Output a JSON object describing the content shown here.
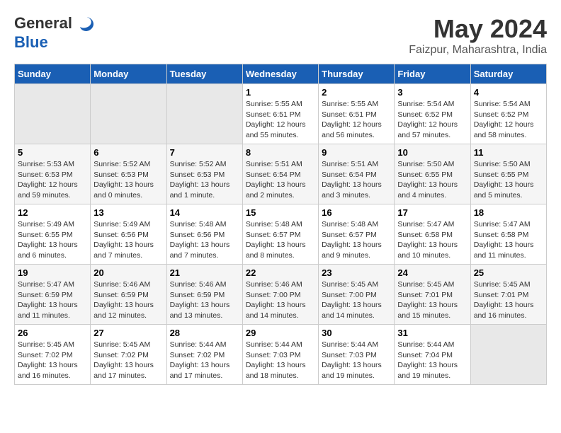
{
  "logo": {
    "line1": "General",
    "line2": "Blue"
  },
  "title": "May 2024",
  "subtitle": "Faizpur, Maharashtra, India",
  "days_of_week": [
    "Sunday",
    "Monday",
    "Tuesday",
    "Wednesday",
    "Thursday",
    "Friday",
    "Saturday"
  ],
  "weeks": [
    [
      {
        "num": "",
        "info": ""
      },
      {
        "num": "",
        "info": ""
      },
      {
        "num": "",
        "info": ""
      },
      {
        "num": "1",
        "info": "Sunrise: 5:55 AM\nSunset: 6:51 PM\nDaylight: 12 hours\nand 55 minutes."
      },
      {
        "num": "2",
        "info": "Sunrise: 5:55 AM\nSunset: 6:51 PM\nDaylight: 12 hours\nand 56 minutes."
      },
      {
        "num": "3",
        "info": "Sunrise: 5:54 AM\nSunset: 6:52 PM\nDaylight: 12 hours\nand 57 minutes."
      },
      {
        "num": "4",
        "info": "Sunrise: 5:54 AM\nSunset: 6:52 PM\nDaylight: 12 hours\nand 58 minutes."
      }
    ],
    [
      {
        "num": "5",
        "info": "Sunrise: 5:53 AM\nSunset: 6:53 PM\nDaylight: 12 hours\nand 59 minutes."
      },
      {
        "num": "6",
        "info": "Sunrise: 5:52 AM\nSunset: 6:53 PM\nDaylight: 13 hours\nand 0 minutes."
      },
      {
        "num": "7",
        "info": "Sunrise: 5:52 AM\nSunset: 6:53 PM\nDaylight: 13 hours\nand 1 minute."
      },
      {
        "num": "8",
        "info": "Sunrise: 5:51 AM\nSunset: 6:54 PM\nDaylight: 13 hours\nand 2 minutes."
      },
      {
        "num": "9",
        "info": "Sunrise: 5:51 AM\nSunset: 6:54 PM\nDaylight: 13 hours\nand 3 minutes."
      },
      {
        "num": "10",
        "info": "Sunrise: 5:50 AM\nSunset: 6:55 PM\nDaylight: 13 hours\nand 4 minutes."
      },
      {
        "num": "11",
        "info": "Sunrise: 5:50 AM\nSunset: 6:55 PM\nDaylight: 13 hours\nand 5 minutes."
      }
    ],
    [
      {
        "num": "12",
        "info": "Sunrise: 5:49 AM\nSunset: 6:55 PM\nDaylight: 13 hours\nand 6 minutes."
      },
      {
        "num": "13",
        "info": "Sunrise: 5:49 AM\nSunset: 6:56 PM\nDaylight: 13 hours\nand 7 minutes."
      },
      {
        "num": "14",
        "info": "Sunrise: 5:48 AM\nSunset: 6:56 PM\nDaylight: 13 hours\nand 7 minutes."
      },
      {
        "num": "15",
        "info": "Sunrise: 5:48 AM\nSunset: 6:57 PM\nDaylight: 13 hours\nand 8 minutes."
      },
      {
        "num": "16",
        "info": "Sunrise: 5:48 AM\nSunset: 6:57 PM\nDaylight: 13 hours\nand 9 minutes."
      },
      {
        "num": "17",
        "info": "Sunrise: 5:47 AM\nSunset: 6:58 PM\nDaylight: 13 hours\nand 10 minutes."
      },
      {
        "num": "18",
        "info": "Sunrise: 5:47 AM\nSunset: 6:58 PM\nDaylight: 13 hours\nand 11 minutes."
      }
    ],
    [
      {
        "num": "19",
        "info": "Sunrise: 5:47 AM\nSunset: 6:59 PM\nDaylight: 13 hours\nand 11 minutes."
      },
      {
        "num": "20",
        "info": "Sunrise: 5:46 AM\nSunset: 6:59 PM\nDaylight: 13 hours\nand 12 minutes."
      },
      {
        "num": "21",
        "info": "Sunrise: 5:46 AM\nSunset: 6:59 PM\nDaylight: 13 hours\nand 13 minutes."
      },
      {
        "num": "22",
        "info": "Sunrise: 5:46 AM\nSunset: 7:00 PM\nDaylight: 13 hours\nand 14 minutes."
      },
      {
        "num": "23",
        "info": "Sunrise: 5:45 AM\nSunset: 7:00 PM\nDaylight: 13 hours\nand 14 minutes."
      },
      {
        "num": "24",
        "info": "Sunrise: 5:45 AM\nSunset: 7:01 PM\nDaylight: 13 hours\nand 15 minutes."
      },
      {
        "num": "25",
        "info": "Sunrise: 5:45 AM\nSunset: 7:01 PM\nDaylight: 13 hours\nand 16 minutes."
      }
    ],
    [
      {
        "num": "26",
        "info": "Sunrise: 5:45 AM\nSunset: 7:02 PM\nDaylight: 13 hours\nand 16 minutes."
      },
      {
        "num": "27",
        "info": "Sunrise: 5:45 AM\nSunset: 7:02 PM\nDaylight: 13 hours\nand 17 minutes."
      },
      {
        "num": "28",
        "info": "Sunrise: 5:44 AM\nSunset: 7:02 PM\nDaylight: 13 hours\nand 17 minutes."
      },
      {
        "num": "29",
        "info": "Sunrise: 5:44 AM\nSunset: 7:03 PM\nDaylight: 13 hours\nand 18 minutes."
      },
      {
        "num": "30",
        "info": "Sunrise: 5:44 AM\nSunset: 7:03 PM\nDaylight: 13 hours\nand 19 minutes."
      },
      {
        "num": "31",
        "info": "Sunrise: 5:44 AM\nSunset: 7:04 PM\nDaylight: 13 hours\nand 19 minutes."
      },
      {
        "num": "",
        "info": ""
      }
    ]
  ]
}
